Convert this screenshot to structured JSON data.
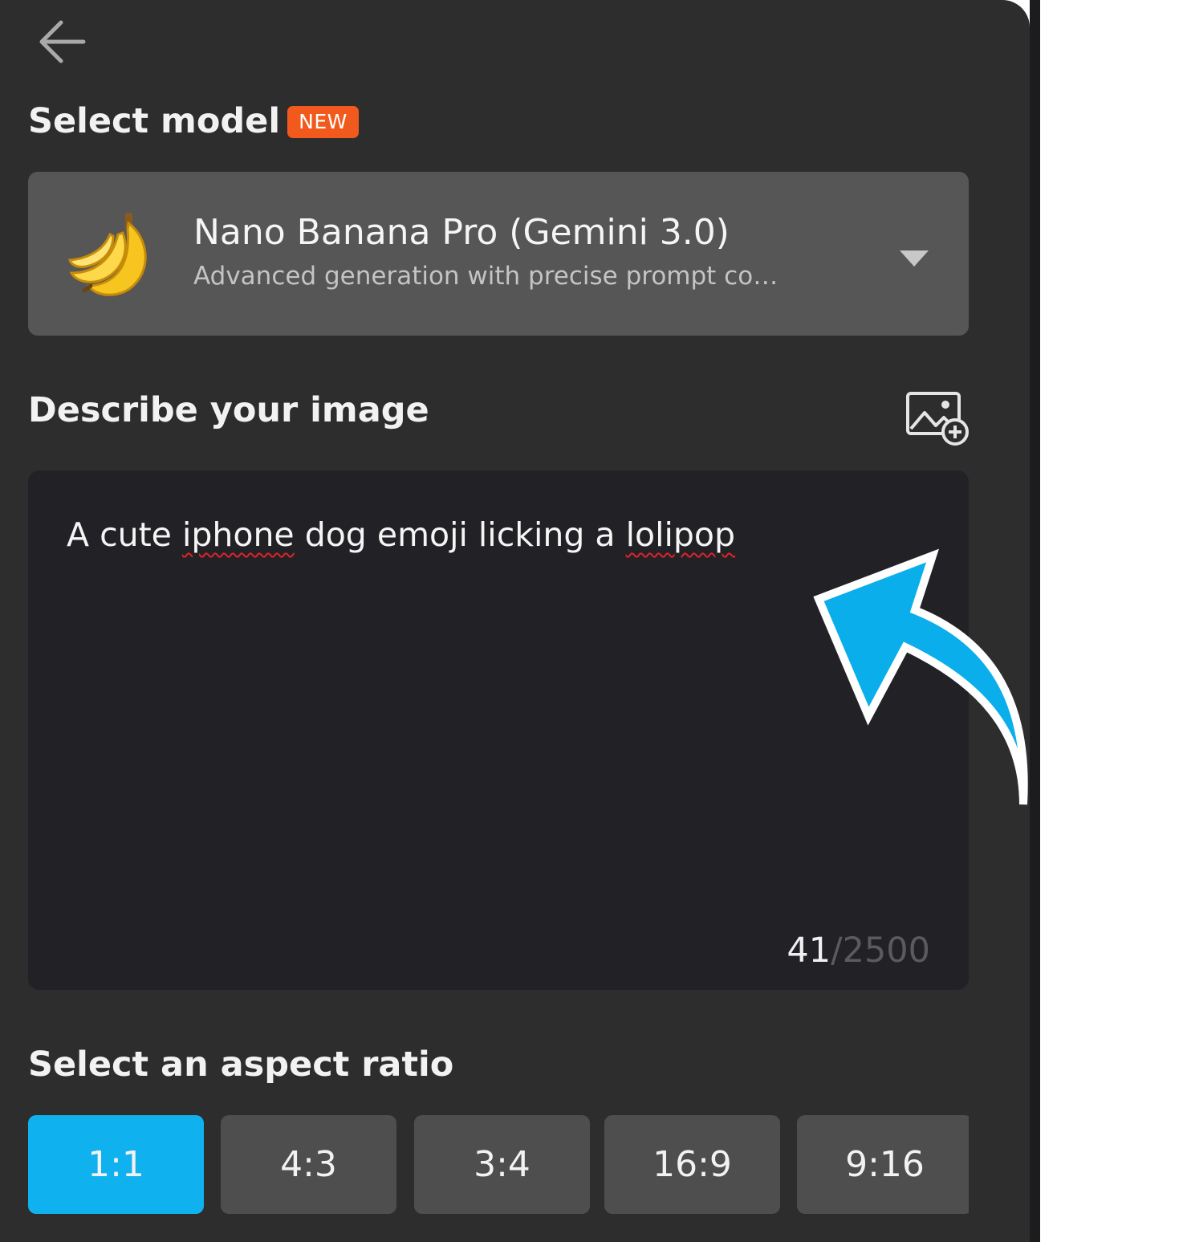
{
  "header": {
    "back_icon": "arrow-left-icon"
  },
  "model_section": {
    "title": "Select model",
    "badge": "NEW",
    "badge_color": "#f25a1d",
    "selected_model": {
      "icon": "banana-icon",
      "name": "Nano Banana Pro (Gemini 3.0)",
      "description": "Advanced generation with precise prompt co…"
    },
    "dropdown_icon": "caret-down-icon"
  },
  "prompt_section": {
    "title": "Describe your image",
    "add_image_icon": "image-add-icon",
    "prompt_words": [
      "A cute ",
      "iphone",
      " dog emoji licking a ",
      "lolipop"
    ],
    "char_count": "41",
    "char_limit": "/2500"
  },
  "aspect_section": {
    "title": "Select an aspect ratio",
    "options": [
      "1:1",
      "4:3",
      "3:4",
      "16:9",
      "9:16"
    ],
    "selected": "1:1",
    "accent": "#0fb1ee"
  },
  "annotation": {
    "icon": "curved-arrow-icon",
    "color": "#0aaeea"
  }
}
